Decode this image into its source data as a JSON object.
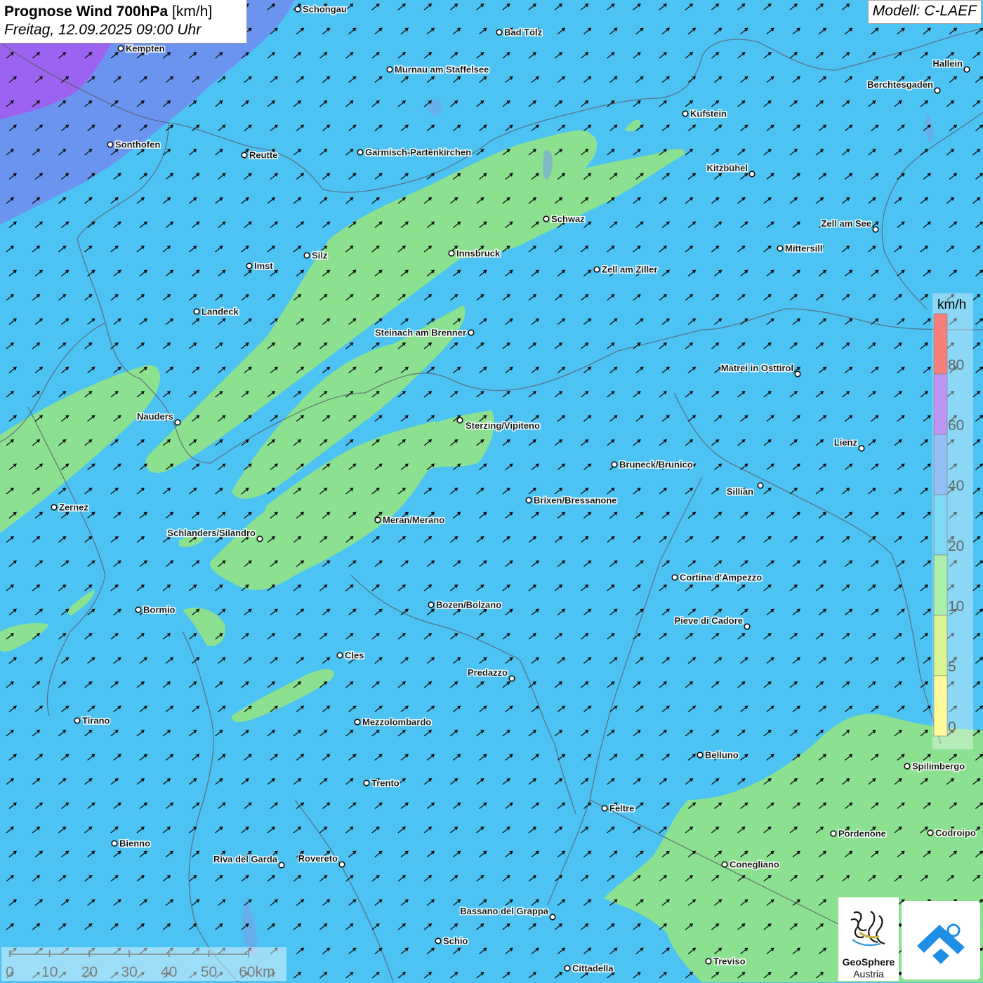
{
  "header": {
    "title_bold": "Prognose Wind 700hPa",
    "title_unit": "[km/h]",
    "datetime": "Freitag, 12.09.2025 09:00 Uhr",
    "model": "Modell: C-LAEF"
  },
  "legend": {
    "unit": "km/h",
    "bands": [
      {
        "color": "#fdf666",
        "from": 0,
        "to": 5
      },
      {
        "color": "#c8ef5a",
        "from": 5,
        "to": 10
      },
      {
        "color": "#7ee67e",
        "from": 10,
        "to": 20
      },
      {
        "color": "#36c6f0",
        "from": 20,
        "to": 40
      },
      {
        "color": "#5b9cf2",
        "from": 40,
        "to": 60
      },
      {
        "color": "#9a5cf0",
        "from": 60,
        "to": 80
      },
      {
        "color": "#f23b37",
        "from": 80,
        "to": 100
      }
    ],
    "tick_labels": [
      "80",
      "60",
      "40",
      "20",
      "10",
      "5",
      "0"
    ]
  },
  "scalebar": {
    "labels": [
      "0",
      "10",
      "20",
      "30",
      "40",
      "50",
      "60km"
    ]
  },
  "logo": {
    "name_bold": "GeoSphere",
    "name": "Austria"
  },
  "colors": {
    "background": "#4cc3f2",
    "wind_light": "#8fe38a",
    "wind_strong": "#6f8ff0",
    "wind_very_strong": "#9b63f0",
    "arrow": "#111111",
    "border": "#5a5a6a",
    "logo_blue": "#1f8fe6"
  },
  "wind_arrow_direction": "southwest-to-northeast",
  "cities": [
    {
      "name": "Schongau"
    },
    {
      "name": "Kempten"
    },
    {
      "name": "Bad Tölz"
    },
    {
      "name": "Murnau am Staffelsee"
    },
    {
      "name": "Hallein"
    },
    {
      "name": "Berchtesgaden"
    },
    {
      "name": "Kufstein"
    },
    {
      "name": "Sonthofen"
    },
    {
      "name": "Reutte"
    },
    {
      "name": "Garmisch-Partenkirchen"
    },
    {
      "name": "Kitzbühel"
    },
    {
      "name": "Schwaz"
    },
    {
      "name": "Zell am See"
    },
    {
      "name": "Mittersill"
    },
    {
      "name": "Innsbruck"
    },
    {
      "name": "Imst"
    },
    {
      "name": "Silz"
    },
    {
      "name": "Zell am Ziller"
    },
    {
      "name": "Landeck"
    },
    {
      "name": "Steinach am Brenner"
    },
    {
      "name": "Matrei in Osttirol"
    },
    {
      "name": "Nauders"
    },
    {
      "name": "Sterzing/Vipiteno"
    },
    {
      "name": "Lienz"
    },
    {
      "name": "Bruneck/Brunico"
    },
    {
      "name": "Sillian"
    },
    {
      "name": "Zernez"
    },
    {
      "name": "Brixen/Bressanone"
    },
    {
      "name": "Meran/Merano"
    },
    {
      "name": "Schlanders/Silandro"
    },
    {
      "name": "Cortina d'Ampezzo"
    },
    {
      "name": "Bozen/Bolzano"
    },
    {
      "name": "Bormio"
    },
    {
      "name": "Pieve di Cadore"
    },
    {
      "name": "Cles"
    },
    {
      "name": "Predazzo"
    },
    {
      "name": "Tirano"
    },
    {
      "name": "Mezzolombardo"
    },
    {
      "name": "Belluno"
    },
    {
      "name": "Spilimbergo"
    },
    {
      "name": "Trento"
    },
    {
      "name": "Feltre"
    },
    {
      "name": "Bienno"
    },
    {
      "name": "Pordenone"
    },
    {
      "name": "Codroipo"
    },
    {
      "name": "Riva del Garda"
    },
    {
      "name": "Rovereto"
    },
    {
      "name": "Conegliano"
    },
    {
      "name": "Bassano del Grappa"
    },
    {
      "name": "Schio"
    },
    {
      "name": "Treviso"
    },
    {
      "name": "Cittadella"
    }
  ]
}
